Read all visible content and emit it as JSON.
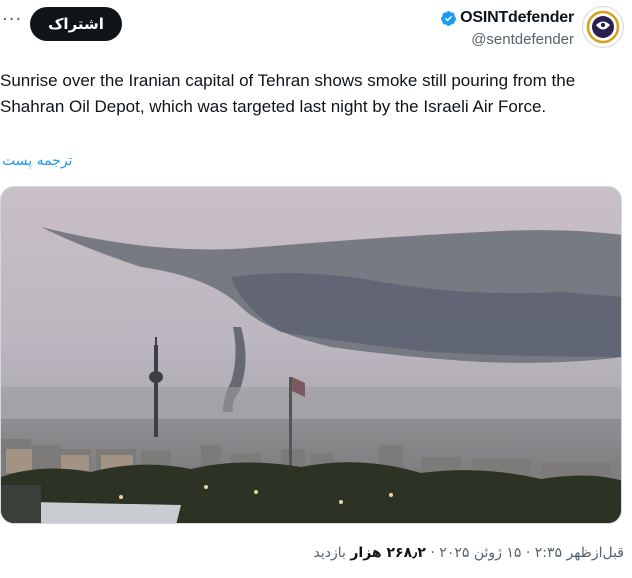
{
  "header": {
    "more_label": "···",
    "follow_label": "اشتراک",
    "display_name": "OSINTdefender",
    "handle": "@sentdefender",
    "verified_color": "#1d9bf0",
    "follow_bg": "#0f1419"
  },
  "tweet": {
    "text": "Sunrise over the Iranian capital of Tehran shows smoke still pouring from the Shahran Oil Depot, which was targeted last night by the Israeli Air Force.",
    "translate_label": "ترجمه پست"
  },
  "meta": {
    "time": "قبل‌ازظهر ۲:۳۵",
    "date": "۱۵ ژوئن ۲۰۲۵",
    "views_count": "۲۶۸٫۲ هزار",
    "views_label": "بازدید",
    "separator": "·"
  }
}
